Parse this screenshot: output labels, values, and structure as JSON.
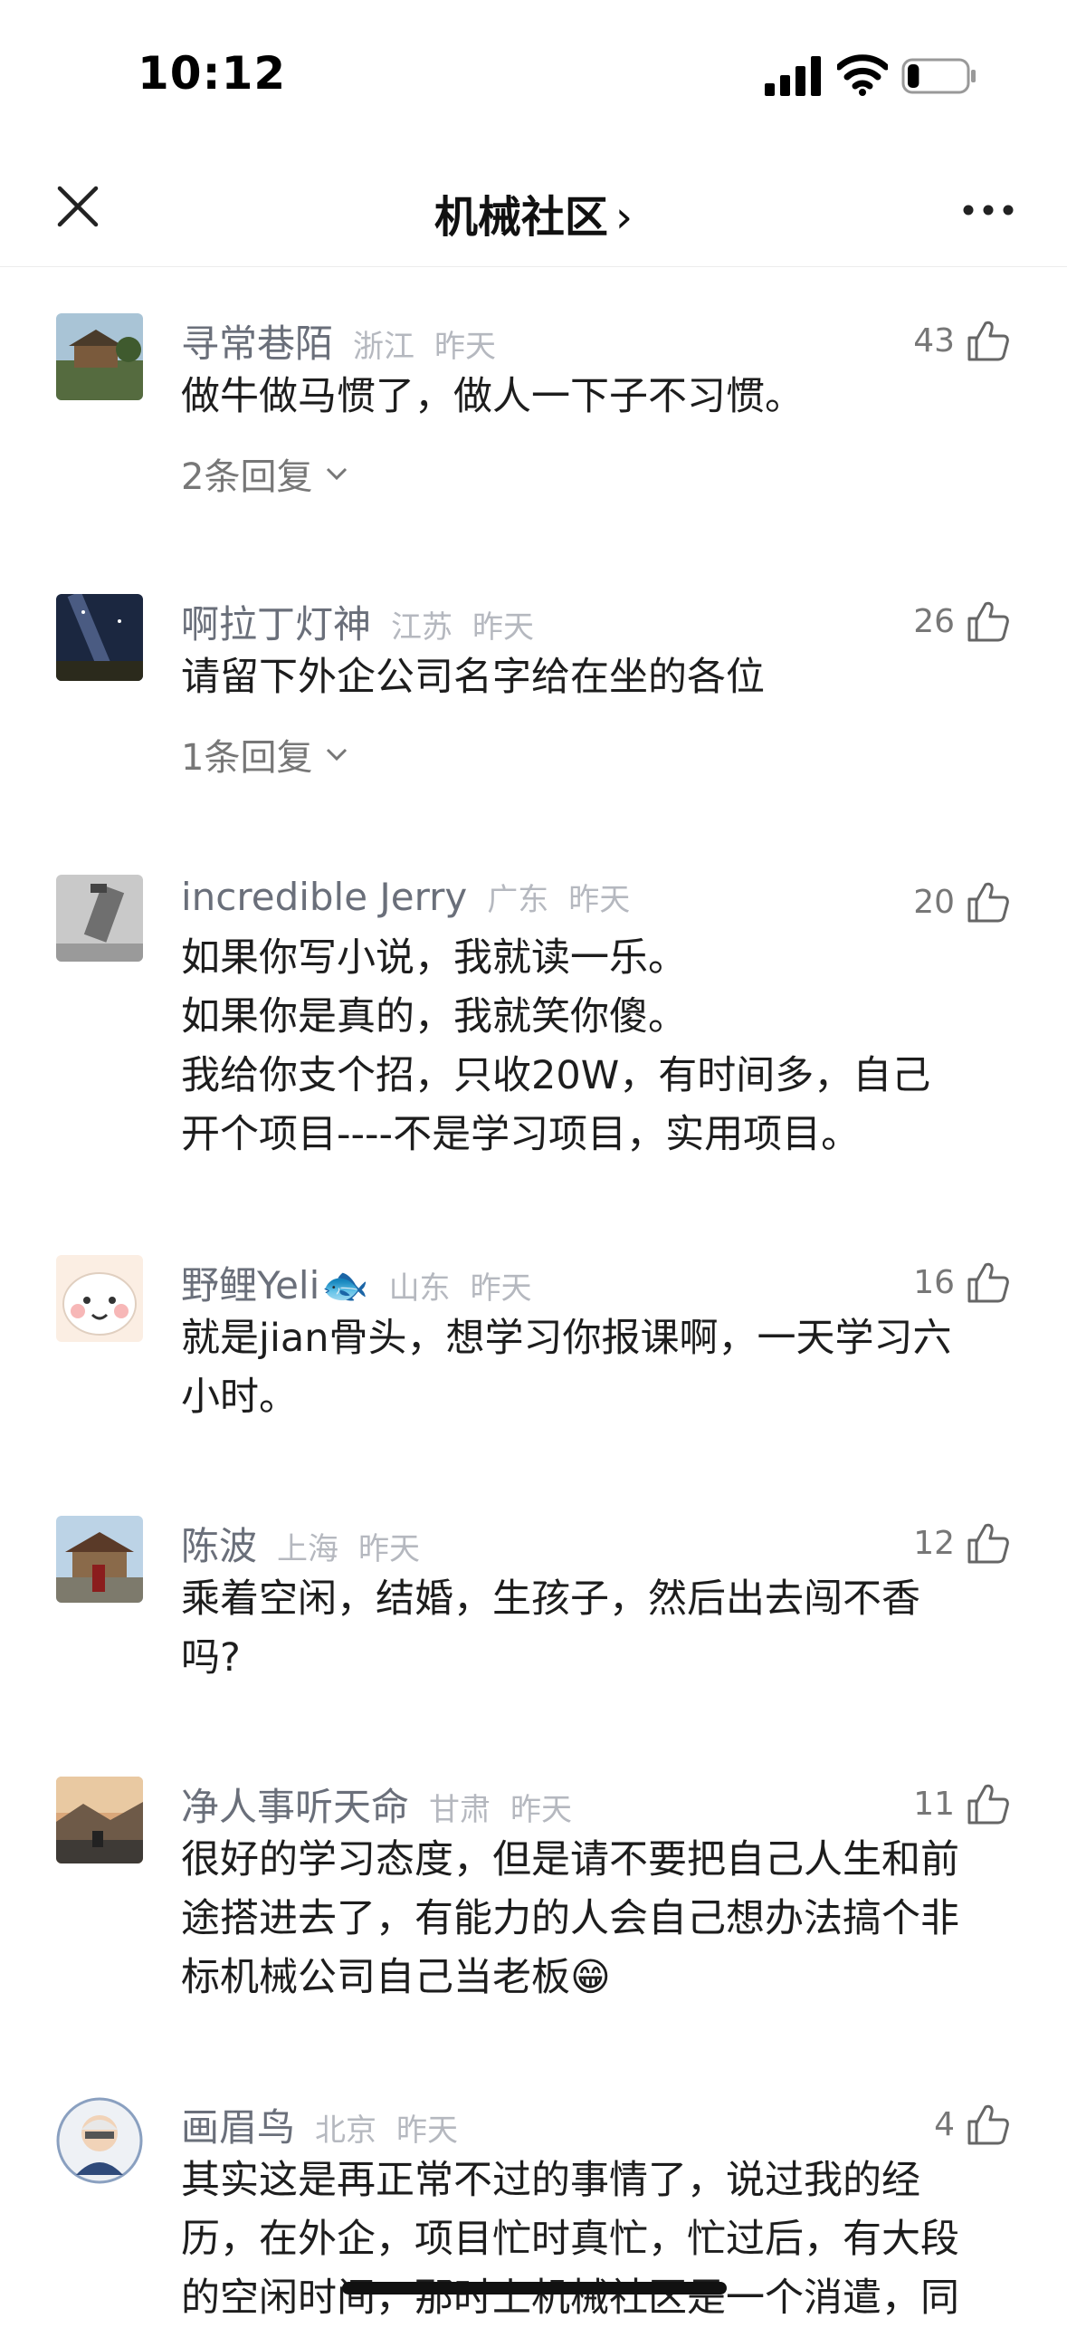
{
  "status_bar": {
    "time": "10:12",
    "battery_level": 0.2
  },
  "nav": {
    "title": "机械社区",
    "title_chevron": "›",
    "close_icon": "close-icon",
    "more_icon": "more-dots-icon"
  },
  "comments": [
    {
      "user": "寻常巷陌",
      "location": "浙江",
      "time": "昨天",
      "likes": "43",
      "lines": [
        "做牛做马惯了，做人一下子不习惯。"
      ],
      "replies": "2条回复",
      "avatar": "garden-photo-avatar"
    },
    {
      "user": "啊拉丁灯神",
      "location": "江苏",
      "time": "昨天",
      "likes": "26",
      "lines": [
        "请留下外企公司名字给在坐的各位"
      ],
      "replies": "1条回复",
      "avatar": "night-sky-avatar"
    },
    {
      "user": "incredible Jerry",
      "location": "广东",
      "time": "昨天",
      "likes": "20",
      "lines": [
        "如果你写小说，我就读一乐。",
        "如果你是真的，我就笑你傻。",
        "我给你支个招，只收20W，有时间多，自己",
        "开个项目----不是学习项目，实用项目。"
      ],
      "avatar": "machine-photo-avatar"
    },
    {
      "user": "野鲤Yeli",
      "user_emoji": "🐟",
      "location": "山东",
      "time": "昨天",
      "likes": "16",
      "lines": [
        "就是jian骨头，想学习你报课啊，一天学习六",
        "小时。"
      ],
      "avatar": "cartoon-avatar"
    },
    {
      "user": "陈波",
      "location": "上海",
      "time": "昨天",
      "likes": "12",
      "lines": [
        "乘着空闲，结婚，生孩子，然后出去闯不香",
        "吗?"
      ],
      "avatar": "temple-photo-avatar"
    },
    {
      "user": "净人事听天命",
      "location": "甘肃",
      "time": "昨天",
      "likes": "11",
      "lines": [
        "很好的学习态度，但是请不要把自己人生和前",
        "途搭进去了，有能力的人会自己想办法搞个非",
        "标机械公司自己当老板😁"
      ],
      "avatar": "sunset-boat-avatar"
    },
    {
      "user": "画眉鸟",
      "location": "北京",
      "time": "昨天",
      "likes": "4",
      "lines": [
        "其实这是再正常不过的事情了，说过我的经",
        "历，在外企，项目忙时真忙，忙过后，有大段",
        "的空闲时间，那时上机械社区是一个消遣，同"
      ],
      "avatar": "old-man-avatar"
    }
  ]
}
